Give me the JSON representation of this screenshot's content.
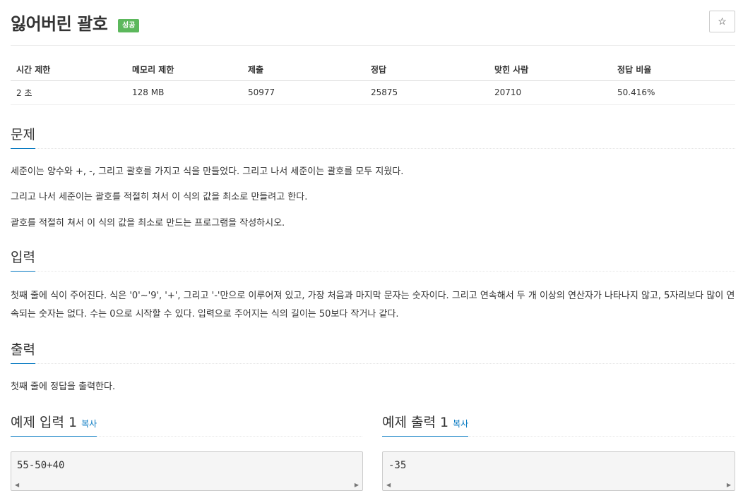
{
  "problem": {
    "title": "잃어버린 괄호",
    "status_badge": "성공",
    "star_icon": "☆"
  },
  "info_table": {
    "headers": [
      "시간 제한",
      "메모리 제한",
      "제출",
      "정답",
      "맞힌 사람",
      "정답 비율"
    ],
    "values": [
      "2 초",
      "128 MB",
      "50977",
      "25875",
      "20710",
      "50.416%"
    ]
  },
  "sections": {
    "description": {
      "title": "문제",
      "paragraphs": [
        "세준이는 양수와 +, -, 그리고 괄호를 가지고 식을 만들었다. 그리고 나서 세준이는 괄호를 모두 지웠다.",
        "그리고 나서 세준이는 괄호를 적절히 쳐서 이 식의 값을 최소로 만들려고 한다.",
        "괄호를 적절히 쳐서 이 식의 값을 최소로 만드는 프로그램을 작성하시오."
      ]
    },
    "input": {
      "title": "입력",
      "text": "첫째 줄에 식이 주어진다. 식은 '0'~'9', '+', 그리고 '-'만으로 이루어져 있고, 가장 처음과 마지막 문자는 숫자이다. 그리고 연속해서 두 개 이상의 연산자가 나타나지 않고, 5자리보다 많이 연속되는 숫자는 없다. 수는 0으로 시작할 수 있다. 입력으로 주어지는 식의 길이는 50보다 작거나 같다."
    },
    "output": {
      "title": "출력",
      "text": "첫째 줄에 정답을 출력한다."
    }
  },
  "samples": {
    "input": {
      "title": "예제 입력 1",
      "copy": "복사",
      "value": "55-50+40"
    },
    "output": {
      "title": "예제 출력 1",
      "copy": "복사",
      "value": "-35"
    },
    "scroll_left_icon": "◀",
    "scroll_right_icon": "▶"
  },
  "colors": {
    "accent": "#0076c0",
    "success": "#5cb85c"
  }
}
